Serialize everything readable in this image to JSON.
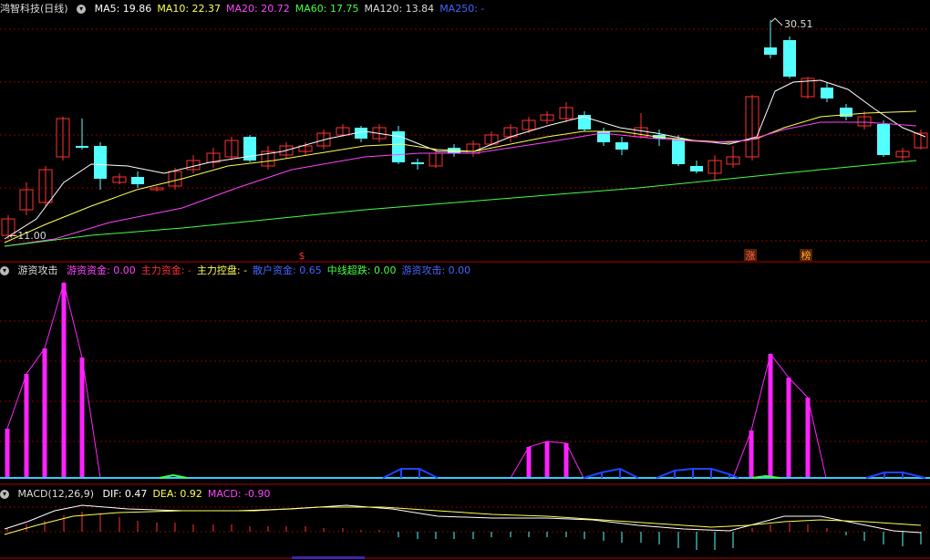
{
  "main": {
    "title": "鸿智科技(日线)",
    "ma_labels": [
      {
        "text": "MA5: 19.86",
        "color": "#ffffff"
      },
      {
        "text": "MA10: 22.37",
        "color": "#ffff55"
      },
      {
        "text": "MA20: 20.72",
        "color": "#ff44ff"
      },
      {
        "text": "MA60: 17.75",
        "color": "#44ff44"
      },
      {
        "text": "MA120: 13.84",
        "color": "#dddddd"
      },
      {
        "text": "MA250: -",
        "color": "#4466ff"
      }
    ],
    "high_label": "30.51",
    "low_label": "11.00",
    "markers": [
      {
        "text": "$",
        "color": "#ff3030"
      },
      {
        "text": "涨",
        "color": "#ff6060"
      },
      {
        "text": "榜",
        "color": "#ffaa33"
      }
    ]
  },
  "indicator": {
    "title": "游资攻击",
    "labels": [
      {
        "text": "游资资金: 0.00",
        "color": "#ff44ff"
      },
      {
        "text": "主力资金: -",
        "color": "#ff3030"
      },
      {
        "text": "主力控盘: -",
        "color": "#ffff55"
      },
      {
        "text": "散户资金: 0.65",
        "color": "#4466ff"
      },
      {
        "text": "中线超跌: 0.00",
        "color": "#44ff44"
      },
      {
        "text": "游资攻击: 0.00",
        "color": "#4466ff"
      }
    ]
  },
  "macd": {
    "title": "MACD(12,26,9)",
    "labels": [
      {
        "text": "DIF: 0.47",
        "color": "#ffffff"
      },
      {
        "text": "DEA: 0.92",
        "color": "#ffff55"
      },
      {
        "text": "MACD: -0.90",
        "color": "#ff44ff"
      }
    ]
  },
  "colors": {
    "up": "#ff3232",
    "down": "#54ffff",
    "grid": "#8a0000"
  }
}
